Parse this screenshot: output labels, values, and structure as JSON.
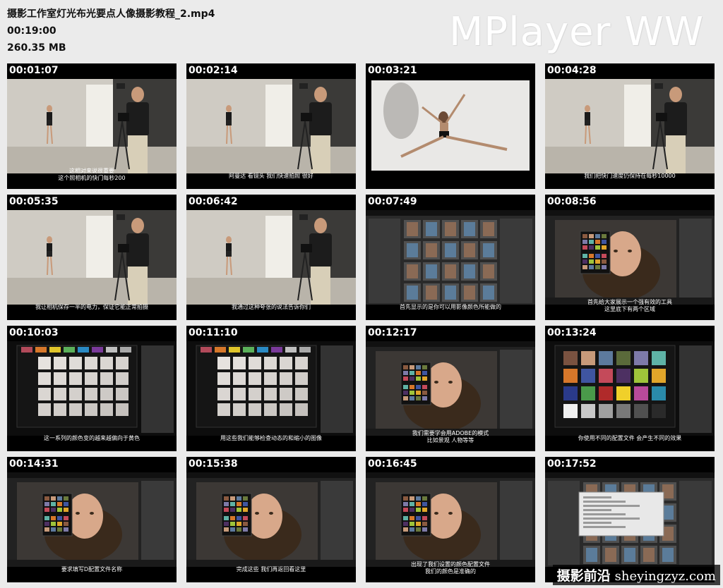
{
  "file": {
    "name": "摄影工作室灯光布光要点人像摄影教程_2.mp4",
    "duration": "00:19:00",
    "size": "260.35 MB"
  },
  "logo": "MPlayer WW",
  "watermark": {
    "cn": "摄影前沿",
    "url": "sheyingzyz.com"
  },
  "thumbnails": [
    {
      "time": "00:01:07",
      "scene": "studio",
      "sub1": "这相对来说很重要",
      "sub2": "这个照相机的快门每秒200"
    },
    {
      "time": "00:02:14",
      "scene": "studio-shoot",
      "sub1": "阿曼达  看镜头  我们快速拍照  很好",
      "sub2": ""
    },
    {
      "time": "00:03:21",
      "scene": "photo",
      "sub1": "",
      "sub2": ""
    },
    {
      "time": "00:04:28",
      "scene": "studio",
      "sub1": "我们把快门速度仍保持在每秒10000",
      "sub2": ""
    },
    {
      "time": "00:05:35",
      "scene": "studio",
      "sub1": "我让相机保存一半的电力，保证它能正常拍摄",
      "sub2": ""
    },
    {
      "time": "00:06:42",
      "scene": "studio-shoot",
      "sub1": "我通过这种夸张的说法告诉你们",
      "sub2": ""
    },
    {
      "time": "00:07:49",
      "scene": "lightroom-grid",
      "sub1": "首先显示的是你可以用影像颜色所能做的",
      "sub2": ""
    },
    {
      "time": "00:08:56",
      "scene": "lightroom-portrait",
      "sub1": "首先给大家展示一个强有效的工具",
      "sub2": "这里底下有两个区域"
    },
    {
      "time": "00:10:03",
      "scene": "colorchecker",
      "sub1": "这一系列的颜色变的越来越偏向于黄色",
      "sub2": ""
    },
    {
      "time": "00:11:10",
      "scene": "colorchecker",
      "sub1": "用这些我们能够检查动态的和缩小的图像",
      "sub2": ""
    },
    {
      "time": "00:12:17",
      "scene": "lightroom-portrait",
      "sub1": "我们需要学会用ADOBE的模式",
      "sub2": "比如景观  人物等等"
    },
    {
      "time": "00:13:24",
      "scene": "colorchecker-full",
      "sub1": "你使用不同的配置文件  会产生不同的效果",
      "sub2": ""
    },
    {
      "time": "00:14:31",
      "scene": "lightroom-portrait",
      "sub1": "要求填写D配置文件名称",
      "sub2": ""
    },
    {
      "time": "00:15:38",
      "scene": "lightroom-portrait",
      "sub1": "完成这些  我们再返回看这里",
      "sub2": ""
    },
    {
      "time": "00:16:45",
      "scene": "lightroom-portrait",
      "sub1": "出现了我们设置的颜色配置文件",
      "sub2": "我们的颜色是准确的"
    },
    {
      "time": "00:17:52",
      "scene": "lightroom-dialog",
      "sub1": "",
      "sub2": ""
    }
  ]
}
